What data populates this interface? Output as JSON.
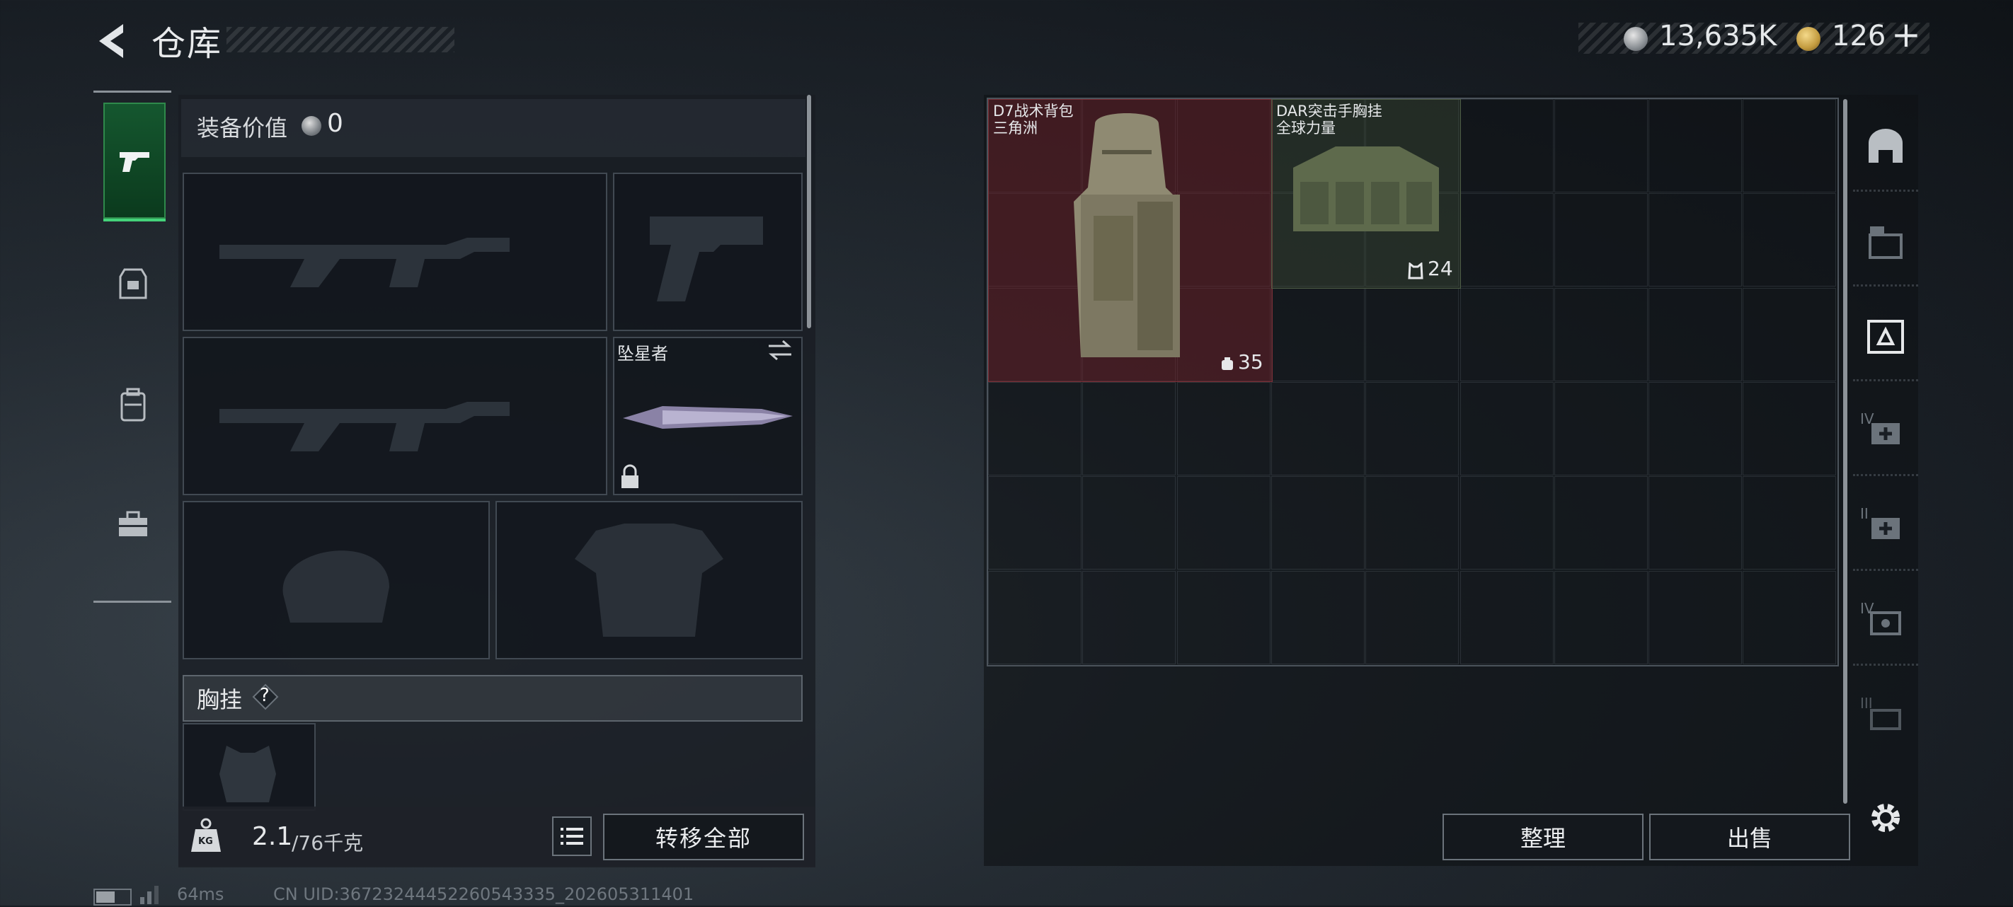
{
  "header": {
    "title": "仓库"
  },
  "currency": {
    "silver_value": "13,635K",
    "gold_value": "126",
    "plus": "+"
  },
  "equipment": {
    "value_label": "装备价值",
    "value": "0",
    "secondary_slot_item_name": "坠星者",
    "chest_rig_label": "胸挂",
    "help": "?"
  },
  "bottom": {
    "weight_current": "2.1",
    "weight_max": "/76千克",
    "weight_icon_text": "KG",
    "transfer_all": "转移全部",
    "sort": "整理",
    "sell": "出售"
  },
  "status": {
    "ping": "64ms",
    "uid": "CN UID:36723244452260543335_202605311401"
  },
  "storage": {
    "items": [
      {
        "name": "D7战术背包",
        "source": "三角洲",
        "count": "35",
        "count_icon": "backpack-capacity-icon"
      },
      {
        "name": "DAR突击手胸挂",
        "source": "全球力量",
        "count": "24",
        "count_icon": "vest-capacity-icon"
      }
    ],
    "right_rail_badges": [
      "IV",
      "II",
      "IV",
      "III"
    ]
  },
  "colors": {
    "accent_green": "#44d27a",
    "backpack_bg": "#78222a"
  }
}
